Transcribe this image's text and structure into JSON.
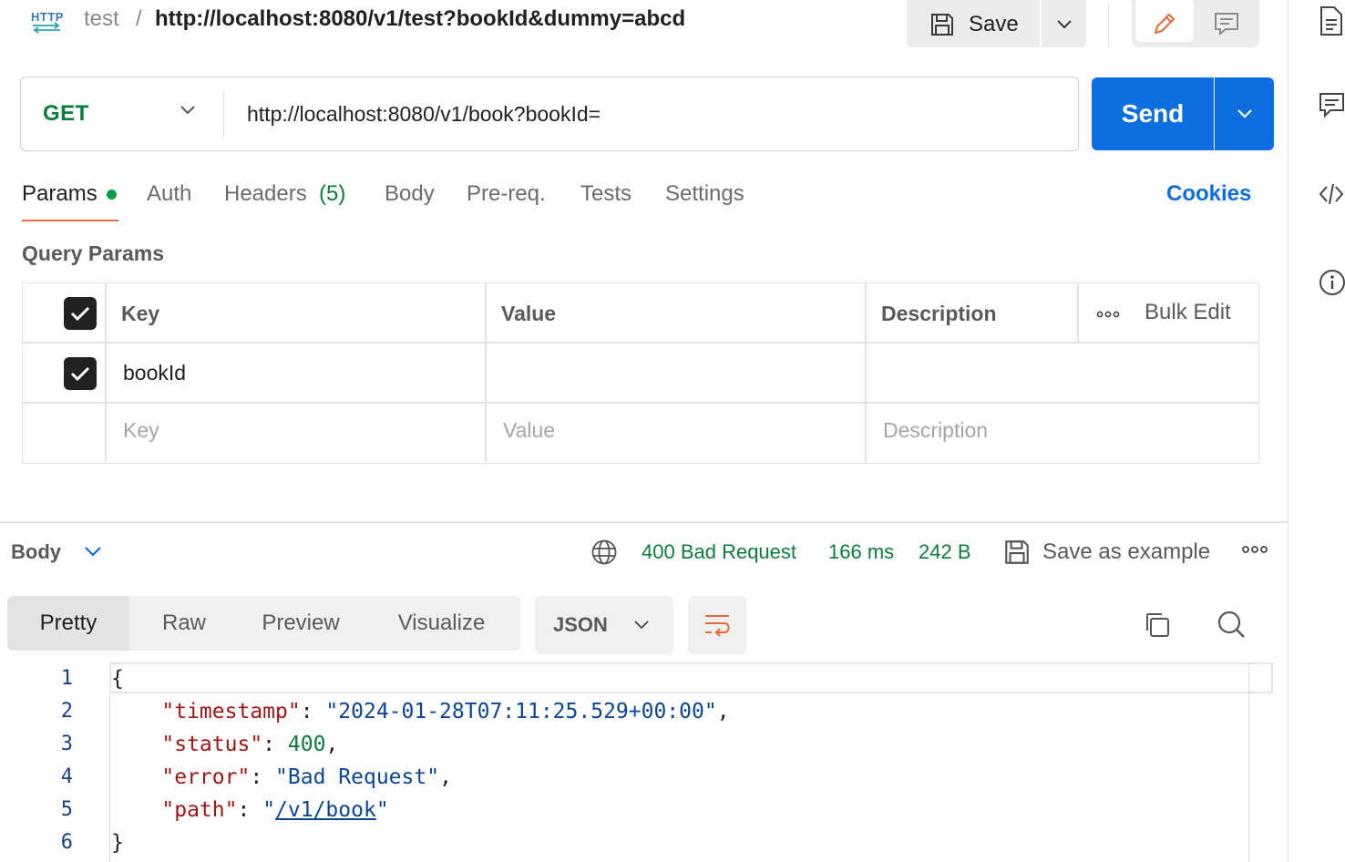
{
  "header": {
    "badge": "HTTP",
    "breadcrumb_parent": "test",
    "breadcrumb_sep": "/",
    "title": "http://localhost:8080/v1/test?bookId&dummy=abcd",
    "save_label": "Save"
  },
  "request": {
    "method": "GET",
    "url": "http://localhost:8080/v1/book?bookId=",
    "send_label": "Send"
  },
  "tabs": {
    "params": "Params",
    "auth": "Auth",
    "headers": "Headers",
    "headers_count": "(5)",
    "body": "Body",
    "prereq": "Pre-req.",
    "tests": "Tests",
    "settings": "Settings",
    "cookies": "Cookies"
  },
  "query_params": {
    "title": "Query Params",
    "columns": {
      "key": "Key",
      "value": "Value",
      "description": "Description",
      "bulk_edit": "Bulk Edit"
    },
    "rows": [
      {
        "checked": true,
        "key": "bookId",
        "value": "",
        "description": ""
      }
    ],
    "placeholders": {
      "key": "Key",
      "value": "Value",
      "description": "Description"
    }
  },
  "response": {
    "section_label": "Body",
    "status": "400 Bad Request",
    "time": "166 ms",
    "size": "242 B",
    "save_example": "Save as example",
    "view_tabs": [
      "Pretty",
      "Raw",
      "Preview",
      "Visualize"
    ],
    "format": "JSON",
    "line_numbers": [
      "1",
      "2",
      "3",
      "4",
      "5",
      "6"
    ],
    "json": {
      "timestamp": "2024-01-28T07:11:25.529+00:00",
      "status": "400",
      "error": "Bad Request",
      "path": "/v1/book"
    }
  },
  "colors": {
    "accent": "#f26b3a",
    "primary": "#0d6ee0",
    "success": "#0c7c3d"
  }
}
